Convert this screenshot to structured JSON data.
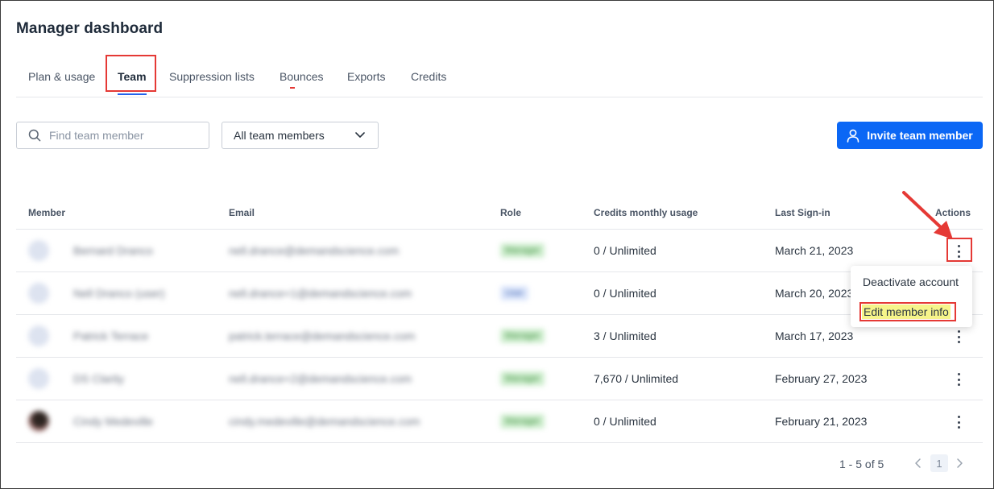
{
  "page": {
    "title": "Manager dashboard"
  },
  "tabs": [
    {
      "label": "Plan & usage"
    },
    {
      "label": "Team"
    },
    {
      "label": "Suppression lists"
    },
    {
      "label": "Bounces"
    },
    {
      "label": "Exports"
    },
    {
      "label": "Credits"
    }
  ],
  "active_tab": "Team",
  "toolbar": {
    "search_placeholder": "Find team member",
    "filter_value": "All team members",
    "invite_label": "Invite team member"
  },
  "table": {
    "headers": {
      "member": "Member",
      "email": "Email",
      "role": "Role",
      "credits": "Credits monthly usage",
      "last_signin": "Last Sign-in",
      "actions": "Actions"
    },
    "rows": [
      {
        "name": "Bernard Dranco",
        "email": "nell.drance@demandscience.com",
        "role": "Manager",
        "credits": "0 / Unlimited",
        "last_signin": "March 21, 2023"
      },
      {
        "name": "Nell Dranco (user)",
        "email": "nell.drance+1@demandscience.com",
        "role": "User",
        "credits": "0 / Unlimited",
        "last_signin": "March 20, 2023"
      },
      {
        "name": "Patrick Terrace",
        "email": "patrick.terrace@demandscience.com",
        "role": "Manager",
        "credits": "3 / Unlimited",
        "last_signin": "March 17, 2023"
      },
      {
        "name": "DS Clarity",
        "email": "nell.drance+2@demandscience.com",
        "role": "Manager",
        "credits": "7,670 / Unlimited",
        "last_signin": "February 27, 2023"
      },
      {
        "name": "Cindy Medeville",
        "email": "cindy.medeville@demandscience.com",
        "role": "Manager",
        "credits": "0 / Unlimited",
        "last_signin": "February 21, 2023"
      }
    ]
  },
  "actions_menu": {
    "items": [
      {
        "label": "Deactivate account"
      },
      {
        "label": "Edit member info"
      }
    ]
  },
  "pagination": {
    "summary": "1 - 5 of 5",
    "current_page": "1"
  },
  "colors": {
    "primary": "#0b67f5",
    "annotation": "#e53935",
    "highlight": "#f6f48a"
  }
}
